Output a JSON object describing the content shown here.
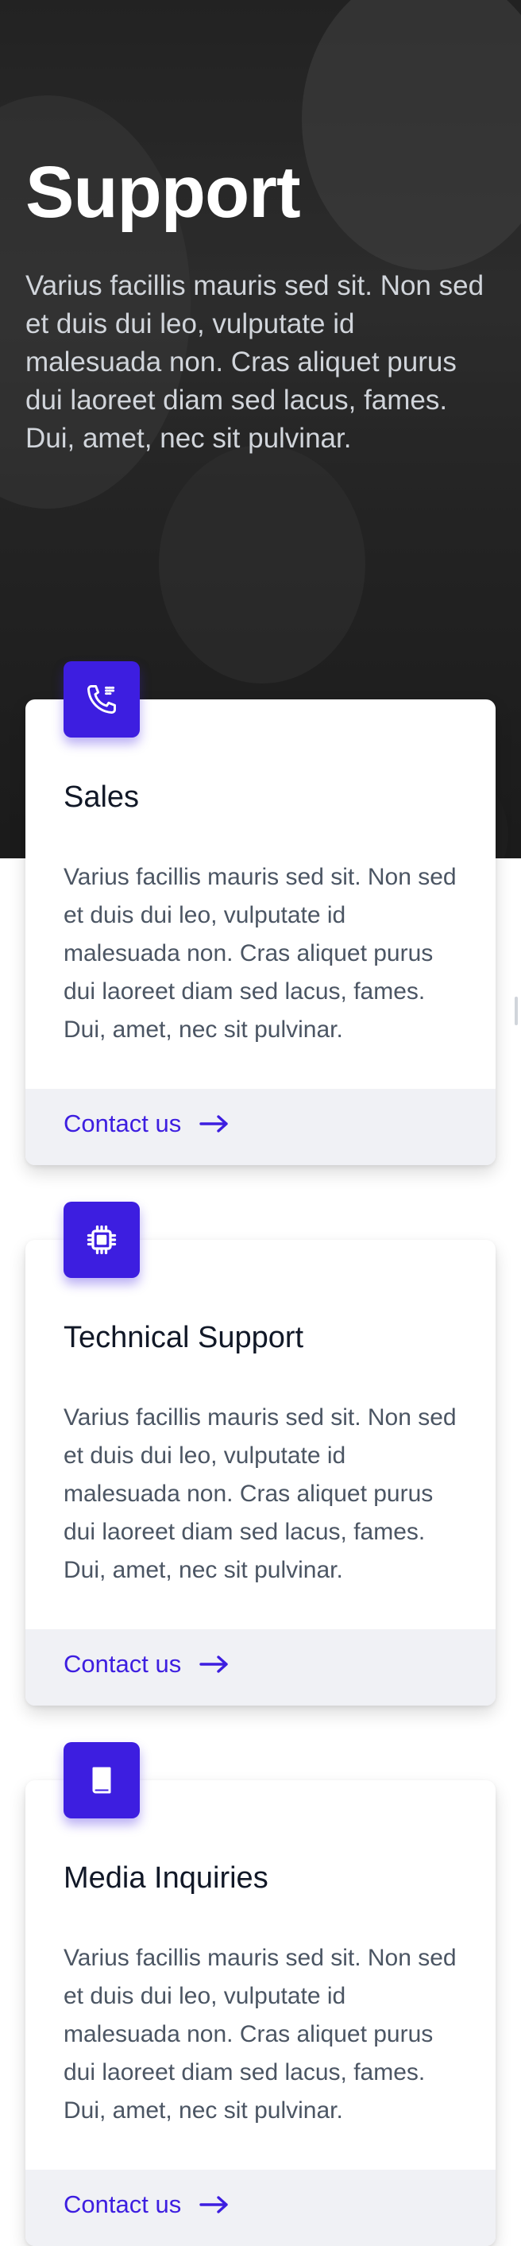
{
  "hero": {
    "title": "Support",
    "text": "Varius facillis mauris sed sit. Non sed et duis dui leo, vulputate id malesuada non. Cras aliquet purus dui laoreet diam sed lacus, fames. Dui, amet, nec sit pulvinar."
  },
  "colors": {
    "accent": "#3d1ee0",
    "footer_bg": "#f0f1f5"
  },
  "cards": [
    {
      "icon": "phone-icon",
      "title": "Sales",
      "text": "Varius facillis mauris sed sit. Non sed et duis dui leo, vulputate id malesuada non. Cras aliquet purus dui laoreet diam sed lacus, fames. Dui, amet, nec sit pulvinar.",
      "link": "Contact us"
    },
    {
      "icon": "chip-icon",
      "title": "Technical Support",
      "text": "Varius facillis mauris sed sit. Non sed et duis dui leo, vulputate id malesuada non. Cras aliquet purus dui laoreet diam sed lacus, fames. Dui, amet, nec sit pulvinar.",
      "link": "Contact us"
    },
    {
      "icon": "book-icon",
      "title": "Media Inquiries",
      "text": "Varius facillis mauris sed sit. Non sed et duis dui leo, vulputate id malesuada non. Cras aliquet purus dui laoreet diam sed lacus, fames. Dui, amet, nec sit pulvinar.",
      "link": "Contact us"
    }
  ]
}
